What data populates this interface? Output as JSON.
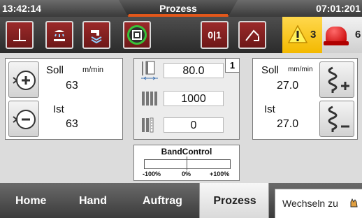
{
  "titlebar": {
    "time_left": "13:42:14",
    "title": "Prozess",
    "time_right": "07:01:201"
  },
  "toolbar": {
    "button_5_label": "0|1"
  },
  "alarms": {
    "warning_count": "3",
    "error_count": "6"
  },
  "speed": {
    "soll_label": "Soll",
    "unit": "m/min",
    "soll_value": "63",
    "ist_label": "Ist",
    "ist_value": "63"
  },
  "center": {
    "badge": "1",
    "row1_value": "80.0",
    "row2_value": "1000",
    "row3_value": "0"
  },
  "pitch": {
    "soll_label": "Soll",
    "unit": "mm/min",
    "soll_value": "27.0",
    "ist_label": "Ist",
    "ist_value": "27.0"
  },
  "band": {
    "title": "BandControl",
    "left_label": "-100%",
    "mid_label": "0%",
    "right_label": "+100%"
  },
  "nav": {
    "home": "Home",
    "hand": "Hand",
    "auftrag": "Auftrag",
    "prozess": "Prozess",
    "switch_label": "Wechseln zu"
  },
  "colors": {
    "accent": "#e2571a",
    "toolbar_button": "#8a2222",
    "active_indicator": "#39c23a",
    "warning": "#f3c300",
    "error": "#d00000"
  }
}
